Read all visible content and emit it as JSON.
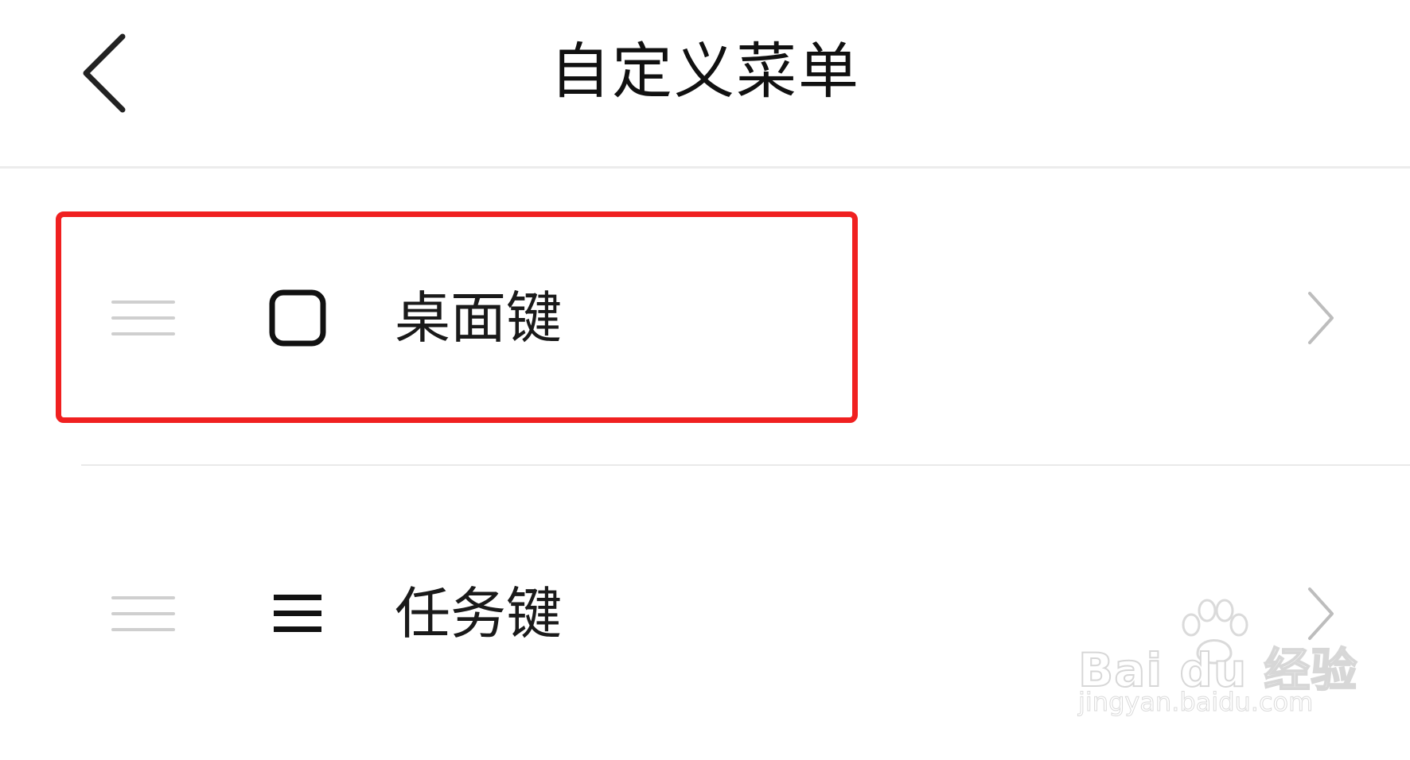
{
  "header": {
    "title": "自定义菜单",
    "back_icon": "chevron-left-icon"
  },
  "menu_items": [
    {
      "label": "桌面键",
      "icon": "square-outline-icon",
      "highlighted": true
    },
    {
      "label": "任务键",
      "icon": "three-lines-icon",
      "highlighted": false
    }
  ],
  "colors": {
    "highlight": "#f02020",
    "divider": "#e9e9e9",
    "handle": "#cfcfcf",
    "chevron": "#bdbdbd"
  },
  "watermark": {
    "brand": "Bai du 经验",
    "url": "jingyan.baidu.com"
  }
}
